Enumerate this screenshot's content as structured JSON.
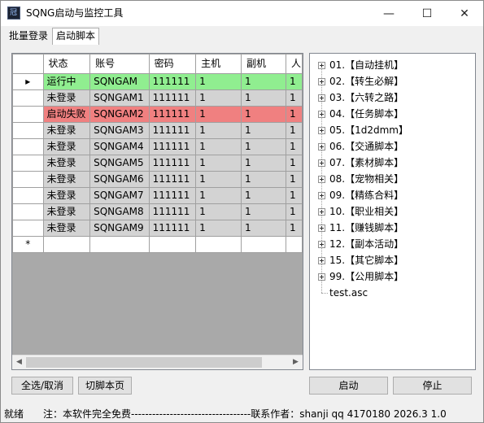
{
  "window": {
    "title": "SQNG启动与监控工具",
    "app_icon_glyph": "冠",
    "minimize_glyph": "—",
    "maximize_glyph": "☐",
    "close_glyph": "✕"
  },
  "tabs": [
    {
      "label": "批量登录"
    },
    {
      "label": "启动脚本"
    }
  ],
  "active_tab": "启动脚本",
  "grid": {
    "columns": [
      "状态",
      "账号",
      "密码",
      "主机",
      "副机",
      "人"
    ],
    "current_row_marker": "▸",
    "new_row_marker": "*",
    "rows": [
      {
        "status": "运行中",
        "account": "SQNGAM",
        "password": "111111",
        "host": "1",
        "sub": "1",
        "extra": "1",
        "color": "#90ee90"
      },
      {
        "status": "未登录",
        "account": "SQNGAM1",
        "password": "111111",
        "host": "1",
        "sub": "1",
        "extra": "1",
        "color": "#d3d3d3"
      },
      {
        "status": "启动失败",
        "account": "SQNGAM2",
        "password": "111111",
        "host": "1",
        "sub": "1",
        "extra": "1",
        "color": "#f08080"
      },
      {
        "status": "未登录",
        "account": "SQNGAM3",
        "password": "111111",
        "host": "1",
        "sub": "1",
        "extra": "1",
        "color": "#d3d3d3"
      },
      {
        "status": "未登录",
        "account": "SQNGAM4",
        "password": "111111",
        "host": "1",
        "sub": "1",
        "extra": "1",
        "color": "#d3d3d3"
      },
      {
        "status": "未登录",
        "account": "SQNGAM5",
        "password": "111111",
        "host": "1",
        "sub": "1",
        "extra": "1",
        "color": "#d3d3d3"
      },
      {
        "status": "未登录",
        "account": "SQNGAM6",
        "password": "111111",
        "host": "1",
        "sub": "1",
        "extra": "1",
        "color": "#d3d3d3"
      },
      {
        "status": "未登录",
        "account": "SQNGAM7",
        "password": "111111",
        "host": "1",
        "sub": "1",
        "extra": "1",
        "color": "#d3d3d3"
      },
      {
        "status": "未登录",
        "account": "SQNGAM8",
        "password": "111111",
        "host": "1",
        "sub": "1",
        "extra": "1",
        "color": "#d3d3d3"
      },
      {
        "status": "未登录",
        "account": "SQNGAM9",
        "password": "111111",
        "host": "1",
        "sub": "1",
        "extra": "1",
        "color": "#d3d3d3"
      }
    ],
    "scroll_left_glyph": "◀",
    "scroll_right_glyph": "▶"
  },
  "tree": {
    "items": [
      "01.【自动挂机】",
      "02.【转生必解】",
      "03.【六转之路】",
      "04.【任务脚本】",
      "05.【1d2dmm】",
      "06.【交通脚本】",
      "07.【素材脚本】",
      "08.【宠物相关】",
      "09.【精练合料】",
      "10.【职业相关】",
      "11.【赚钱脚本】",
      "12.【副本活动】",
      "15.【其它脚本】",
      "99.【公用脚本】"
    ],
    "file": "test.asc"
  },
  "buttons": {
    "select_all": "全选/取消",
    "switch_page": "切脚本页",
    "start": "启动",
    "stop": "停止"
  },
  "status": {
    "ready": "就绪",
    "notice": "注：本软件完全免费----------------------------------联系作者：shanji qq 4170180  2026.3  1.0"
  }
}
